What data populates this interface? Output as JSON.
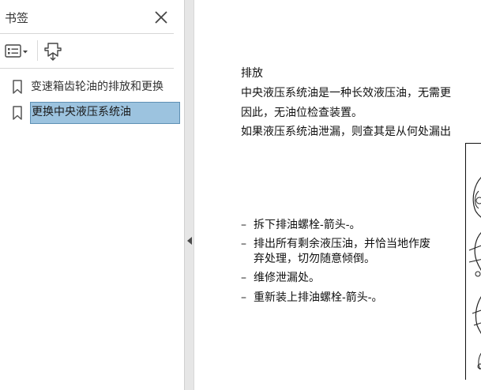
{
  "panel": {
    "title": "书签",
    "bookmarks": [
      {
        "label": "变速箱齿轮油的排放和更换",
        "selected": false
      },
      {
        "label": "更换中央液压系统油",
        "selected": true
      }
    ]
  },
  "document": {
    "heading": "排放",
    "paragraphs": [
      "中央液压系统油是一种长效液压油，无需更",
      "因此，无油位检查装置。",
      "如果液压系统油泄漏，则查其是从何处漏出"
    ],
    "steps": [
      {
        "dash": "–",
        "lines": [
          "拆下排油螺栓-箭头-。"
        ]
      },
      {
        "dash": "–",
        "lines": [
          "排出所有剩余液压油，并恰当地作废",
          "弃处理，切勿随意倾倒。"
        ]
      },
      {
        "dash": "–",
        "lines": [
          "维修泄漏处。"
        ]
      },
      {
        "dash": "–",
        "lines": [
          "重新装上排油螺栓-箭头-。"
        ]
      }
    ]
  },
  "colors": {
    "selection_fill": "#9cc3df",
    "selection_border": "#5e90b4",
    "splitter": "#e6e6e6"
  },
  "icons": {
    "close": "close-icon",
    "options": "options-menu-icon",
    "expand": "expand-bookmark-icon",
    "bookmark": "bookmark-ribbon-icon",
    "collapse": "collapse-panel-arrow-icon"
  }
}
